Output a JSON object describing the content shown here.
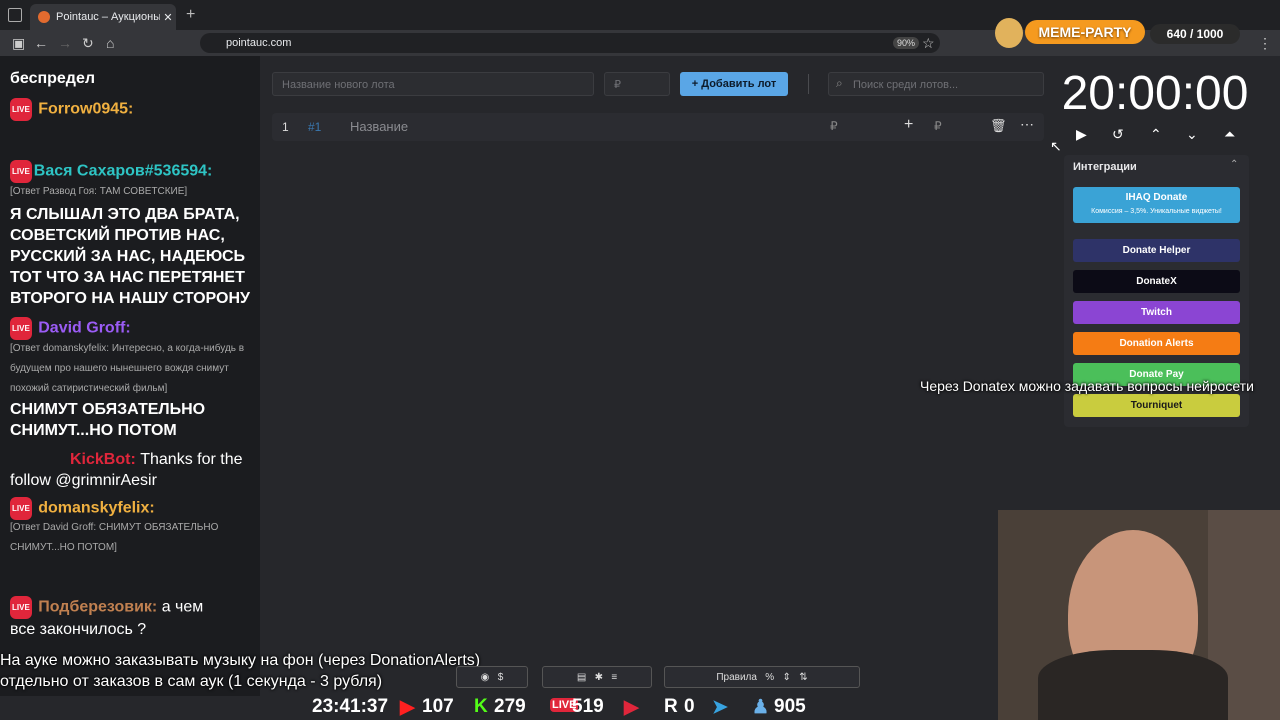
{
  "browser": {
    "tab_title": "Pointauc – Аукционы, лотереи",
    "tab_close": "✕",
    "new_tab": "+",
    "url": "pointauc.com",
    "zoom": "90%"
  },
  "meme": {
    "title": "MEME-PARTY",
    "counter": "640 / 1000"
  },
  "auction": {
    "new_lot_placeholder": "Название нового лота",
    "price_placeholder": "₽",
    "add_lot": "Добавить лот",
    "search_placeholder": "Поиск среди лотов...",
    "lot_index": "1",
    "lot_id": "#1",
    "lot_name": "Название",
    "lot_currency": "₽",
    "lot_add_currency": "₽"
  },
  "timer": {
    "value": "20:00:00"
  },
  "integrations": {
    "title": "Интеграции",
    "items": [
      {
        "label": "IHAQ Donate",
        "sub": "Комиссия – 3,5%. Уникальные виджеты!",
        "color": "#3aa3d6"
      },
      {
        "label": "Donate Helper",
        "color": "#2e3368"
      },
      {
        "label": "DonateX",
        "color": "#0c0b16"
      },
      {
        "label": "Twitch",
        "color": "#8b45d3"
      },
      {
        "label": "Donation Alerts",
        "color": "#f57c14"
      },
      {
        "label": "Donate Pay",
        "color": "#4bbf5a"
      },
      {
        "label": "Tourniquet",
        "color": "#c9cc3e"
      }
    ]
  },
  "chat": {
    "m1": "беспредел",
    "m2_user": "Forrow0945:",
    "m3_user": "Вася Сахаров#536594:",
    "m3_reply": "[Ответ Развод Гоя: ТАМ СОВЕТСКИЕ]",
    "m3_text": "Я СЛЫШАЛ ЭТО ДВА БРАТА, СОВЕТСКИЙ ПРОТИВ НАС, РУССКИЙ ЗА НАС, НАДЕЮСЬ ТОТ ЧТО ЗА НАС ПЕРЕТЯНЕТ ВТОРОГО НА НАШУ СТОРОНУ",
    "m4_user": "David Groff:",
    "m4_reply": "[Ответ domanskyfelix: Интересно, а когда-нибудь в будущем про нашего нынешнего вождя снимут похожий сатиристический фильм]",
    "m4_text": "СНИМУТ ОБЯЗАТЕЛЬНО СНИМУТ...НО ПОТОМ",
    "m5_user": "KickBot:",
    "m5_text": "Thanks for the follow @grimnirAesir",
    "m6_user": "domanskyfelix:",
    "m6_reply": "[Ответ David Groff: СНИМУТ ОБЯЗАТЕЛЬНО СНИМУТ...НО ПОТОМ]",
    "m7_user": "Подберезовик:",
    "m7_text_a": "а чем",
    "m7_text_b": "все закончилось ?",
    "live": "LIVE"
  },
  "overlays": {
    "donatex_note": "Через Donatex можно задавать вопросы нейросети",
    "music_line1": "На ауке можно заказывать музыку на фон (через DonationAlerts)",
    "music_line2": "отдельно от заказов в сам аук (1 секунда - 3 рубля)"
  },
  "toolbar": {
    "rules": "Правила"
  },
  "stats": {
    "time": "23:41:37",
    "youtube": "107",
    "kick": "279",
    "live": "519",
    "rutube": "0",
    "viewers": "905"
  }
}
